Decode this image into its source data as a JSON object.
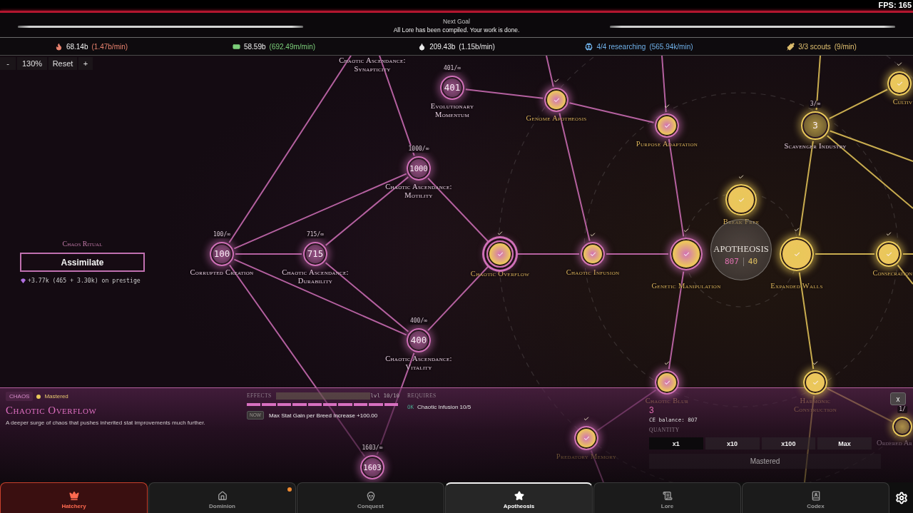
{
  "fps": "FPS: 165",
  "goal": {
    "title": "Next Goal",
    "message": "All Lore has been compiled. Your work is done.",
    "level": 1
  },
  "resources": [
    {
      "amount": "68.14b",
      "rate": "(1.47b/min)",
      "color": "#e8826e",
      "tinted": false
    },
    {
      "amount": "58.59b",
      "rate": "(692.49m/min)",
      "color": "#7ccf7a",
      "tinted": false
    },
    {
      "amount": "209.43b",
      "rate": "(1.15b/min)",
      "color": "#e8e8e8",
      "tinted": false
    },
    {
      "amount": "4/4 researching",
      "rate": "(565.94k/min)",
      "color": "#6fb0e8",
      "tinted": true
    },
    {
      "amount": "3/3 scouts",
      "rate": "(9/min)",
      "color": "#e0c070",
      "tinted": true
    }
  ],
  "zoom": {
    "minus": "-",
    "level": "130%",
    "reset": "Reset",
    "plus": "+"
  },
  "ritual": {
    "title": "Chaos Ritual",
    "button": "Assimilate",
    "reward": "+3.77k (465 + 3.30k) on prestige"
  },
  "core": {
    "title": "APOTHEOSIS",
    "primary": "807",
    "secondary": "40"
  },
  "nodes": [
    {
      "kind": "label_only",
      "label": "Chaotic Ascendance: Synapticity"
    },
    {
      "kind": "mastered",
      "label": "Cultiv",
      "color": "#e8c85a",
      "selected": false
    },
    {
      "kind": "counter",
      "label": "Evolutionary Momentum",
      "count": "401/∞",
      "value": "401",
      "color": "#d070b8",
      "selected": false
    },
    {
      "kind": "mastered",
      "label": "Genome Apotheosis",
      "color": "#d070b8",
      "selected": false
    },
    {
      "kind": "mastered",
      "label": "Purpose Adaptation",
      "color": "#d070b8",
      "selected": false
    },
    {
      "kind": "counter",
      "label": "Scavenger Industry",
      "count": "3/∞",
      "value": "3",
      "color": "#e8c85a",
      "selected": false
    },
    {
      "kind": "counter",
      "label": "Chaotic Ascendance: Motility",
      "count": "1000/∞",
      "value": "1000",
      "color": "#d070b8",
      "selected": false
    },
    {
      "kind": "mastered",
      "label": "Break Free",
      "color": "#e8c85a",
      "selected": false
    },
    {
      "kind": "counter",
      "label": "Corrupted Creation",
      "count": "100/∞",
      "value": "100",
      "color": "#d070b8",
      "selected": false
    },
    {
      "kind": "counter",
      "label": "Chaotic Ascendance: Durability",
      "count": "715/∞",
      "value": "715",
      "color": "#d070b8",
      "selected": false
    },
    {
      "kind": "mastered",
      "label": "Chaotic Overflow",
      "color": "#d070b8",
      "selected": true
    },
    {
      "kind": "mastered",
      "label": "Chaotic Infusion",
      "color": "#d070b8",
      "selected": false
    },
    {
      "kind": "mastered",
      "label": "Genetic Manipulation",
      "color": "#d070b8",
      "selected": false
    },
    {
      "kind": "mastered",
      "label": "Expanded Walls",
      "color": "#e8c85a",
      "selected": false
    },
    {
      "kind": "mastered",
      "label": "Consecration",
      "color": "#e8c85a",
      "selected": false
    },
    {
      "kind": "counter",
      "label": "Chaotic Ascendance: Vitality",
      "count": "400/∞",
      "value": "400",
      "color": "#d070b8",
      "selected": false
    },
    {
      "kind": "mastered",
      "label": "Chaotic Blur",
      "color": "#d070b8",
      "selected": false
    },
    {
      "kind": "mastered",
      "label": "Harmonic Construction",
      "color": "#e8c85a",
      "selected": false
    },
    {
      "kind": "counter",
      "label": "Ordered Ar",
      "count": "1/",
      "color": "#e8c85a",
      "selected": false
    },
    {
      "kind": "mastered",
      "label": "Predatory Memory",
      "color": "#d070b8",
      "selected": false
    },
    {
      "kind": "counter",
      "count": "1603/∞",
      "value": "1603",
      "color": "#d070b8",
      "selected": false
    }
  ],
  "detail": {
    "category": "CHAOS",
    "status": "Mastered",
    "title": "Chaotic Overflow",
    "description": "A deeper surge of chaos that pushes inherited stat improvements much further.",
    "effects_label": "EFFECTS",
    "level_text": "lvl 10/10",
    "level": 1,
    "effects": [
      {
        "tag": "NOW",
        "text": "Max Stat Gain per Breed Increase +100.00"
      }
    ],
    "requires_label": "REQUIRES",
    "requirements": [
      {
        "status": "OK",
        "text": "Chaotic Infusion 10/5",
        "met": true
      }
    ],
    "cost": "3",
    "balance": "CE balance: 807",
    "quantity_label": "QUANTITY",
    "quantities": [
      {
        "label": "x1",
        "selected": true
      },
      {
        "label": "x10",
        "selected": false
      },
      {
        "label": "x100",
        "selected": false
      },
      {
        "label": "Max",
        "selected": false
      }
    ],
    "action": {
      "label": "Mastered",
      "disabled": true
    },
    "close": "x"
  },
  "tabs": [
    {
      "label": "Hatchery",
      "selected": false,
      "alert": true,
      "badge": false
    },
    {
      "label": "Dominion",
      "selected": false,
      "alert": false,
      "badge": true
    },
    {
      "label": "Conquest",
      "selected": false,
      "alert": false,
      "badge": false
    },
    {
      "label": "Apotheosis",
      "selected": true,
      "alert": false,
      "badge": false
    },
    {
      "label": "Lore",
      "selected": false,
      "alert": false,
      "badge": false
    },
    {
      "label": "Codex",
      "selected": false,
      "alert": false,
      "badge": false
    }
  ]
}
